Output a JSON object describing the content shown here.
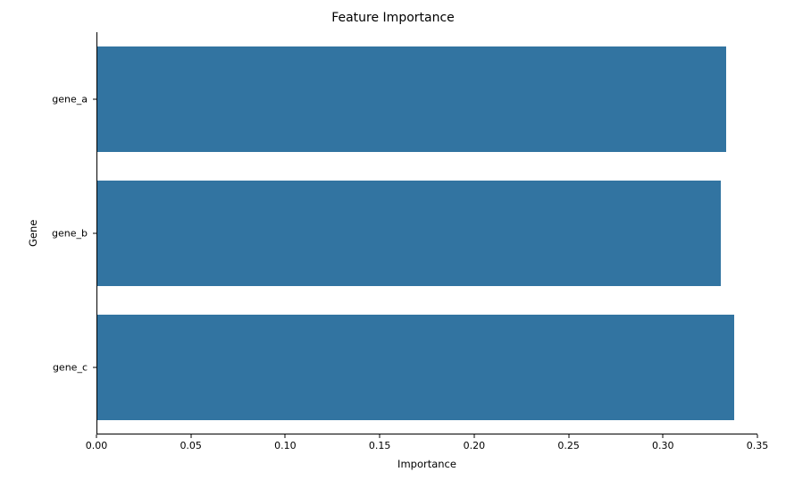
{
  "chart_data": {
    "type": "bar",
    "orientation": "horizontal",
    "categories": [
      "gene_a",
      "gene_b",
      "gene_c"
    ],
    "values": [
      0.333,
      0.33,
      0.337
    ],
    "title": "Feature Importance",
    "xlabel": "Importance",
    "ylabel": "Gene",
    "xlim": [
      0.0,
      0.35
    ],
    "xticks": [
      0.0,
      0.05,
      0.1,
      0.15,
      0.2,
      0.25,
      0.3,
      0.35
    ],
    "xtick_labels": [
      "0.00",
      "0.05",
      "0.10",
      "0.15",
      "0.20",
      "0.25",
      "0.30",
      "0.35"
    ],
    "bar_color": "#3274a1"
  }
}
